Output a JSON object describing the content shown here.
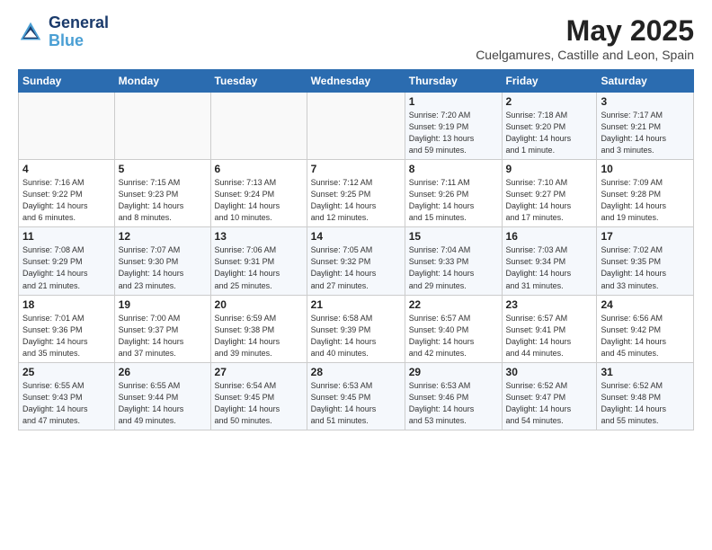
{
  "logo": {
    "line1": "General",
    "line2": "Blue"
  },
  "title": "May 2025",
  "location": "Cuelgamures, Castille and Leon, Spain",
  "headers": [
    "Sunday",
    "Monday",
    "Tuesday",
    "Wednesday",
    "Thursday",
    "Friday",
    "Saturday"
  ],
  "weeks": [
    [
      {
        "day": "",
        "info": ""
      },
      {
        "day": "",
        "info": ""
      },
      {
        "day": "",
        "info": ""
      },
      {
        "day": "",
        "info": ""
      },
      {
        "day": "1",
        "info": "Sunrise: 7:20 AM\nSunset: 9:19 PM\nDaylight: 13 hours\nand 59 minutes."
      },
      {
        "day": "2",
        "info": "Sunrise: 7:18 AM\nSunset: 9:20 PM\nDaylight: 14 hours\nand 1 minute."
      },
      {
        "day": "3",
        "info": "Sunrise: 7:17 AM\nSunset: 9:21 PM\nDaylight: 14 hours\nand 3 minutes."
      }
    ],
    [
      {
        "day": "4",
        "info": "Sunrise: 7:16 AM\nSunset: 9:22 PM\nDaylight: 14 hours\nand 6 minutes."
      },
      {
        "day": "5",
        "info": "Sunrise: 7:15 AM\nSunset: 9:23 PM\nDaylight: 14 hours\nand 8 minutes."
      },
      {
        "day": "6",
        "info": "Sunrise: 7:13 AM\nSunset: 9:24 PM\nDaylight: 14 hours\nand 10 minutes."
      },
      {
        "day": "7",
        "info": "Sunrise: 7:12 AM\nSunset: 9:25 PM\nDaylight: 14 hours\nand 12 minutes."
      },
      {
        "day": "8",
        "info": "Sunrise: 7:11 AM\nSunset: 9:26 PM\nDaylight: 14 hours\nand 15 minutes."
      },
      {
        "day": "9",
        "info": "Sunrise: 7:10 AM\nSunset: 9:27 PM\nDaylight: 14 hours\nand 17 minutes."
      },
      {
        "day": "10",
        "info": "Sunrise: 7:09 AM\nSunset: 9:28 PM\nDaylight: 14 hours\nand 19 minutes."
      }
    ],
    [
      {
        "day": "11",
        "info": "Sunrise: 7:08 AM\nSunset: 9:29 PM\nDaylight: 14 hours\nand 21 minutes."
      },
      {
        "day": "12",
        "info": "Sunrise: 7:07 AM\nSunset: 9:30 PM\nDaylight: 14 hours\nand 23 minutes."
      },
      {
        "day": "13",
        "info": "Sunrise: 7:06 AM\nSunset: 9:31 PM\nDaylight: 14 hours\nand 25 minutes."
      },
      {
        "day": "14",
        "info": "Sunrise: 7:05 AM\nSunset: 9:32 PM\nDaylight: 14 hours\nand 27 minutes."
      },
      {
        "day": "15",
        "info": "Sunrise: 7:04 AM\nSunset: 9:33 PM\nDaylight: 14 hours\nand 29 minutes."
      },
      {
        "day": "16",
        "info": "Sunrise: 7:03 AM\nSunset: 9:34 PM\nDaylight: 14 hours\nand 31 minutes."
      },
      {
        "day": "17",
        "info": "Sunrise: 7:02 AM\nSunset: 9:35 PM\nDaylight: 14 hours\nand 33 minutes."
      }
    ],
    [
      {
        "day": "18",
        "info": "Sunrise: 7:01 AM\nSunset: 9:36 PM\nDaylight: 14 hours\nand 35 minutes."
      },
      {
        "day": "19",
        "info": "Sunrise: 7:00 AM\nSunset: 9:37 PM\nDaylight: 14 hours\nand 37 minutes."
      },
      {
        "day": "20",
        "info": "Sunrise: 6:59 AM\nSunset: 9:38 PM\nDaylight: 14 hours\nand 39 minutes."
      },
      {
        "day": "21",
        "info": "Sunrise: 6:58 AM\nSunset: 9:39 PM\nDaylight: 14 hours\nand 40 minutes."
      },
      {
        "day": "22",
        "info": "Sunrise: 6:57 AM\nSunset: 9:40 PM\nDaylight: 14 hours\nand 42 minutes."
      },
      {
        "day": "23",
        "info": "Sunrise: 6:57 AM\nSunset: 9:41 PM\nDaylight: 14 hours\nand 44 minutes."
      },
      {
        "day": "24",
        "info": "Sunrise: 6:56 AM\nSunset: 9:42 PM\nDaylight: 14 hours\nand 45 minutes."
      }
    ],
    [
      {
        "day": "25",
        "info": "Sunrise: 6:55 AM\nSunset: 9:43 PM\nDaylight: 14 hours\nand 47 minutes."
      },
      {
        "day": "26",
        "info": "Sunrise: 6:55 AM\nSunset: 9:44 PM\nDaylight: 14 hours\nand 49 minutes."
      },
      {
        "day": "27",
        "info": "Sunrise: 6:54 AM\nSunset: 9:45 PM\nDaylight: 14 hours\nand 50 minutes."
      },
      {
        "day": "28",
        "info": "Sunrise: 6:53 AM\nSunset: 9:45 PM\nDaylight: 14 hours\nand 51 minutes."
      },
      {
        "day": "29",
        "info": "Sunrise: 6:53 AM\nSunset: 9:46 PM\nDaylight: 14 hours\nand 53 minutes."
      },
      {
        "day": "30",
        "info": "Sunrise: 6:52 AM\nSunset: 9:47 PM\nDaylight: 14 hours\nand 54 minutes."
      },
      {
        "day": "31",
        "info": "Sunrise: 6:52 AM\nSunset: 9:48 PM\nDaylight: 14 hours\nand 55 minutes."
      }
    ]
  ]
}
